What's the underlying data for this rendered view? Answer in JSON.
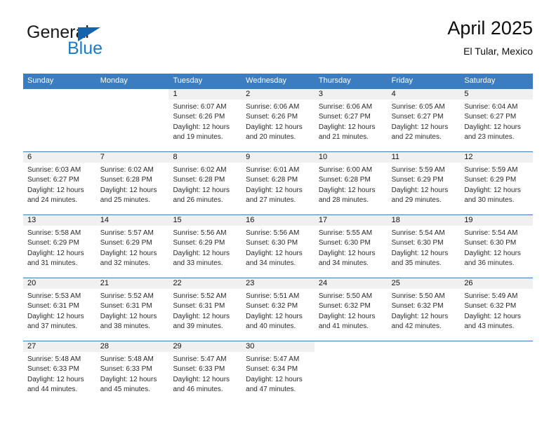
{
  "brand": {
    "word1": "General",
    "word2": "Blue",
    "triangle_color": "#1464ad",
    "blue_color": "#1a7cc8"
  },
  "header": {
    "title": "April 2025",
    "subtitle": "El Tular, Mexico"
  },
  "theme": {
    "header_row_bg": "#3b7dc0",
    "day_number_band_bg": "#f0f0f0",
    "grid_line": "#3b7dc0",
    "text": "#2a2a2a"
  },
  "weekdays": [
    "Sunday",
    "Monday",
    "Tuesday",
    "Wednesday",
    "Thursday",
    "Friday",
    "Saturday"
  ],
  "weeks": [
    [
      {
        "day": "",
        "blank": true,
        "sunrise": "",
        "sunset": "",
        "daylight1": "",
        "daylight2": ""
      },
      {
        "day": "",
        "blank": true,
        "sunrise": "",
        "sunset": "",
        "daylight1": "",
        "daylight2": ""
      },
      {
        "day": "1",
        "sunrise": "Sunrise: 6:07 AM",
        "sunset": "Sunset: 6:26 PM",
        "daylight1": "Daylight: 12 hours",
        "daylight2": "and 19 minutes."
      },
      {
        "day": "2",
        "sunrise": "Sunrise: 6:06 AM",
        "sunset": "Sunset: 6:26 PM",
        "daylight1": "Daylight: 12 hours",
        "daylight2": "and 20 minutes."
      },
      {
        "day": "3",
        "sunrise": "Sunrise: 6:06 AM",
        "sunset": "Sunset: 6:27 PM",
        "daylight1": "Daylight: 12 hours",
        "daylight2": "and 21 minutes."
      },
      {
        "day": "4",
        "sunrise": "Sunrise: 6:05 AM",
        "sunset": "Sunset: 6:27 PM",
        "daylight1": "Daylight: 12 hours",
        "daylight2": "and 22 minutes."
      },
      {
        "day": "5",
        "sunrise": "Sunrise: 6:04 AM",
        "sunset": "Sunset: 6:27 PM",
        "daylight1": "Daylight: 12 hours",
        "daylight2": "and 23 minutes."
      }
    ],
    [
      {
        "day": "6",
        "sunrise": "Sunrise: 6:03 AM",
        "sunset": "Sunset: 6:27 PM",
        "daylight1": "Daylight: 12 hours",
        "daylight2": "and 24 minutes."
      },
      {
        "day": "7",
        "sunrise": "Sunrise: 6:02 AM",
        "sunset": "Sunset: 6:28 PM",
        "daylight1": "Daylight: 12 hours",
        "daylight2": "and 25 minutes."
      },
      {
        "day": "8",
        "sunrise": "Sunrise: 6:02 AM",
        "sunset": "Sunset: 6:28 PM",
        "daylight1": "Daylight: 12 hours",
        "daylight2": "and 26 minutes."
      },
      {
        "day": "9",
        "sunrise": "Sunrise: 6:01 AM",
        "sunset": "Sunset: 6:28 PM",
        "daylight1": "Daylight: 12 hours",
        "daylight2": "and 27 minutes."
      },
      {
        "day": "10",
        "sunrise": "Sunrise: 6:00 AM",
        "sunset": "Sunset: 6:28 PM",
        "daylight1": "Daylight: 12 hours",
        "daylight2": "and 28 minutes."
      },
      {
        "day": "11",
        "sunrise": "Sunrise: 5:59 AM",
        "sunset": "Sunset: 6:29 PM",
        "daylight1": "Daylight: 12 hours",
        "daylight2": "and 29 minutes."
      },
      {
        "day": "12",
        "sunrise": "Sunrise: 5:59 AM",
        "sunset": "Sunset: 6:29 PM",
        "daylight1": "Daylight: 12 hours",
        "daylight2": "and 30 minutes."
      }
    ],
    [
      {
        "day": "13",
        "sunrise": "Sunrise: 5:58 AM",
        "sunset": "Sunset: 6:29 PM",
        "daylight1": "Daylight: 12 hours",
        "daylight2": "and 31 minutes."
      },
      {
        "day": "14",
        "sunrise": "Sunrise: 5:57 AM",
        "sunset": "Sunset: 6:29 PM",
        "daylight1": "Daylight: 12 hours",
        "daylight2": "and 32 minutes."
      },
      {
        "day": "15",
        "sunrise": "Sunrise: 5:56 AM",
        "sunset": "Sunset: 6:29 PM",
        "daylight1": "Daylight: 12 hours",
        "daylight2": "and 33 minutes."
      },
      {
        "day": "16",
        "sunrise": "Sunrise: 5:56 AM",
        "sunset": "Sunset: 6:30 PM",
        "daylight1": "Daylight: 12 hours",
        "daylight2": "and 34 minutes."
      },
      {
        "day": "17",
        "sunrise": "Sunrise: 5:55 AM",
        "sunset": "Sunset: 6:30 PM",
        "daylight1": "Daylight: 12 hours",
        "daylight2": "and 34 minutes."
      },
      {
        "day": "18",
        "sunrise": "Sunrise: 5:54 AM",
        "sunset": "Sunset: 6:30 PM",
        "daylight1": "Daylight: 12 hours",
        "daylight2": "and 35 minutes."
      },
      {
        "day": "19",
        "sunrise": "Sunrise: 5:54 AM",
        "sunset": "Sunset: 6:30 PM",
        "daylight1": "Daylight: 12 hours",
        "daylight2": "and 36 minutes."
      }
    ],
    [
      {
        "day": "20",
        "sunrise": "Sunrise: 5:53 AM",
        "sunset": "Sunset: 6:31 PM",
        "daylight1": "Daylight: 12 hours",
        "daylight2": "and 37 minutes."
      },
      {
        "day": "21",
        "sunrise": "Sunrise: 5:52 AM",
        "sunset": "Sunset: 6:31 PM",
        "daylight1": "Daylight: 12 hours",
        "daylight2": "and 38 minutes."
      },
      {
        "day": "22",
        "sunrise": "Sunrise: 5:52 AM",
        "sunset": "Sunset: 6:31 PM",
        "daylight1": "Daylight: 12 hours",
        "daylight2": "and 39 minutes."
      },
      {
        "day": "23",
        "sunrise": "Sunrise: 5:51 AM",
        "sunset": "Sunset: 6:32 PM",
        "daylight1": "Daylight: 12 hours",
        "daylight2": "and 40 minutes."
      },
      {
        "day": "24",
        "sunrise": "Sunrise: 5:50 AM",
        "sunset": "Sunset: 6:32 PM",
        "daylight1": "Daylight: 12 hours",
        "daylight2": "and 41 minutes."
      },
      {
        "day": "25",
        "sunrise": "Sunrise: 5:50 AM",
        "sunset": "Sunset: 6:32 PM",
        "daylight1": "Daylight: 12 hours",
        "daylight2": "and 42 minutes."
      },
      {
        "day": "26",
        "sunrise": "Sunrise: 5:49 AM",
        "sunset": "Sunset: 6:32 PM",
        "daylight1": "Daylight: 12 hours",
        "daylight2": "and 43 minutes."
      }
    ],
    [
      {
        "day": "27",
        "sunrise": "Sunrise: 5:48 AM",
        "sunset": "Sunset: 6:33 PM",
        "daylight1": "Daylight: 12 hours",
        "daylight2": "and 44 minutes."
      },
      {
        "day": "28",
        "sunrise": "Sunrise: 5:48 AM",
        "sunset": "Sunset: 6:33 PM",
        "daylight1": "Daylight: 12 hours",
        "daylight2": "and 45 minutes."
      },
      {
        "day": "29",
        "sunrise": "Sunrise: 5:47 AM",
        "sunset": "Sunset: 6:33 PM",
        "daylight1": "Daylight: 12 hours",
        "daylight2": "and 46 minutes."
      },
      {
        "day": "30",
        "sunrise": "Sunrise: 5:47 AM",
        "sunset": "Sunset: 6:34 PM",
        "daylight1": "Daylight: 12 hours",
        "daylight2": "and 47 minutes."
      },
      {
        "day": "",
        "blank": true,
        "sunrise": "",
        "sunset": "",
        "daylight1": "",
        "daylight2": ""
      },
      {
        "day": "",
        "blank": true,
        "sunrise": "",
        "sunset": "",
        "daylight1": "",
        "daylight2": ""
      },
      {
        "day": "",
        "blank": true,
        "sunrise": "",
        "sunset": "",
        "daylight1": "",
        "daylight2": ""
      }
    ]
  ]
}
